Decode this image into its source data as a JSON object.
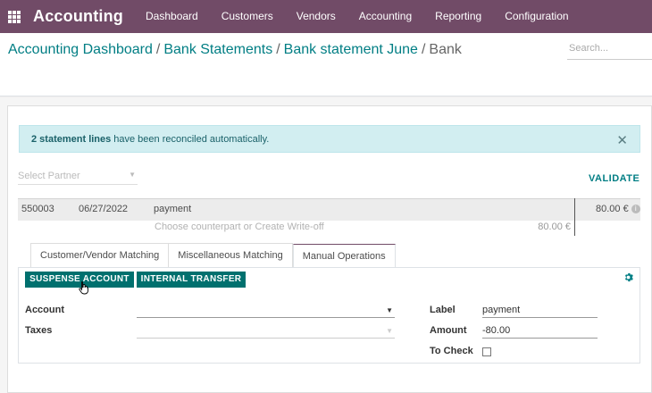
{
  "navbar": {
    "brand": "Accounting",
    "menu": [
      "Dashboard",
      "Customers",
      "Vendors",
      "Accounting",
      "Reporting",
      "Configuration"
    ]
  },
  "breadcrumb": {
    "items": [
      "Accounting Dashboard",
      "Bank Statements",
      "Bank statement June"
    ],
    "current": "Bank"
  },
  "search": {
    "placeholder": "Search..."
  },
  "alert": {
    "bold": "2 statement lines",
    "text": "have been reconciled automatically."
  },
  "partner": {
    "placeholder": "Select Partner"
  },
  "validate_label": "VALIDATE",
  "statement_line": {
    "ref": "550003",
    "date": "06/27/2022",
    "label": "payment",
    "amount": "80.00 €"
  },
  "counterpart": {
    "placeholder": "Choose counterpart or Create Write-off",
    "amount": "80.00 €"
  },
  "tabs": [
    "Customer/Vendor Matching",
    "Miscellaneous Matching",
    "Manual Operations"
  ],
  "active_tab": "Manual Operations",
  "buttons": {
    "suspense": "SUSPENSE ACCOUNT",
    "internal": "INTERNAL TRANSFER"
  },
  "form": {
    "account_label": "Account",
    "taxes_label": "Taxes",
    "label_label": "Label",
    "label_value": "payment",
    "amount_label": "Amount",
    "amount_value": "-80.00",
    "to_check_label": "To Check"
  },
  "colors": {
    "navbar": "#714b67",
    "primary": "#00706e",
    "link": "#017e84",
    "alert_bg": "#d2eef1"
  }
}
